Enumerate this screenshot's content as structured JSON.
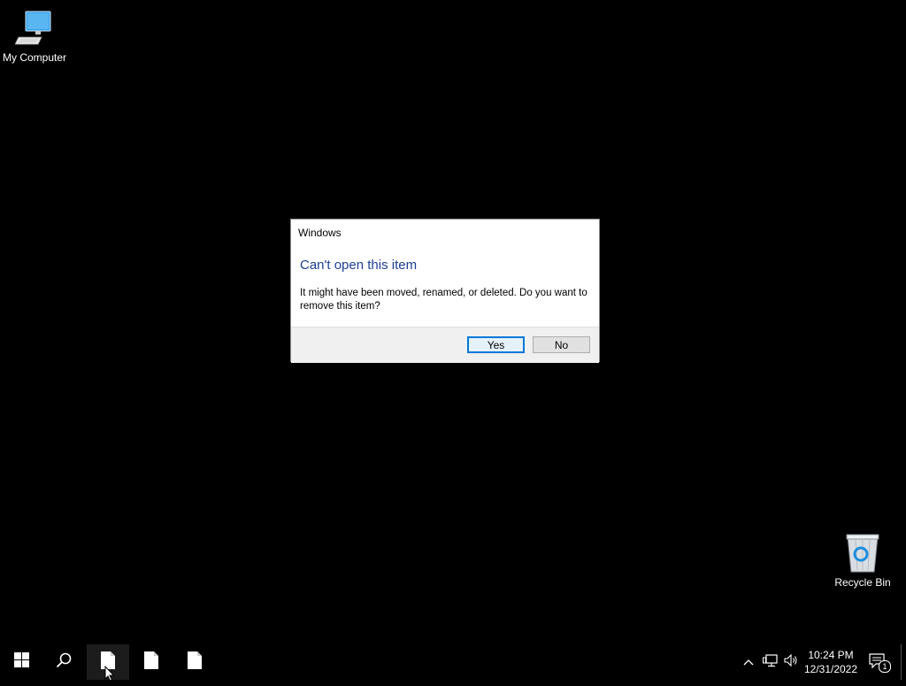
{
  "desktop": {
    "icons": [
      {
        "label": "My Computer",
        "icon": "monitor-icon"
      },
      {
        "label": "Recycle Bin",
        "icon": "recycle-bin-icon"
      }
    ]
  },
  "dialog": {
    "caption": "Windows",
    "heading": "Can't open this item",
    "message": "It might have been moved, renamed, or deleted. Do you want to remove this item?",
    "yes_label": "Yes",
    "no_label": "No"
  },
  "taskbar": {
    "start_icon": "windows-logo-icon",
    "search_icon": "search-icon",
    "pinned": [
      "file-icon",
      "file-icon",
      "file-icon"
    ],
    "clock": {
      "time": "10:24 PM",
      "date": "12/31/2022"
    },
    "notification_count": "1"
  },
  "colors": {
    "accent": "#0078d7",
    "heading": "#1c3f94",
    "desktop_bg": "#000000"
  }
}
